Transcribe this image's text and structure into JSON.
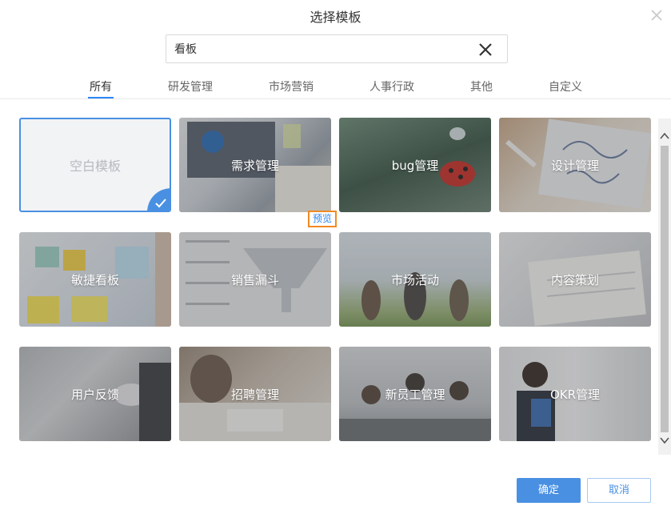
{
  "dialog": {
    "title": "选择模板",
    "close_icon": "close-icon"
  },
  "search": {
    "value": "看板",
    "placeholder": "",
    "clear_icon": "clear-x-icon"
  },
  "tabs": [
    {
      "label": "所有",
      "active": true
    },
    {
      "label": "研发管理",
      "active": false
    },
    {
      "label": "市场营销",
      "active": false
    },
    {
      "label": "人事行政",
      "active": false
    },
    {
      "label": "其他",
      "active": false
    },
    {
      "label": "自定义",
      "active": false
    }
  ],
  "templates": [
    {
      "label": "空白模板",
      "selected": true
    },
    {
      "label": "需求管理",
      "selected": false
    },
    {
      "label": "bug管理",
      "selected": false
    },
    {
      "label": "设计管理",
      "selected": false
    },
    {
      "label": "敏捷看板",
      "selected": false
    },
    {
      "label": "销售漏斗",
      "selected": false
    },
    {
      "label": "市场活动",
      "selected": false
    },
    {
      "label": "内容策划",
      "selected": false
    },
    {
      "label": "用户反馈",
      "selected": false
    },
    {
      "label": "招聘管理",
      "selected": false
    },
    {
      "label": "新员工管理",
      "selected": false
    },
    {
      "label": "OKR管理",
      "selected": false
    }
  ],
  "preview_label": "预览",
  "buttons": {
    "ok": "确定",
    "cancel": "取消"
  },
  "colors": {
    "accent": "#4a90e2",
    "preview_border": "#f08a24"
  }
}
